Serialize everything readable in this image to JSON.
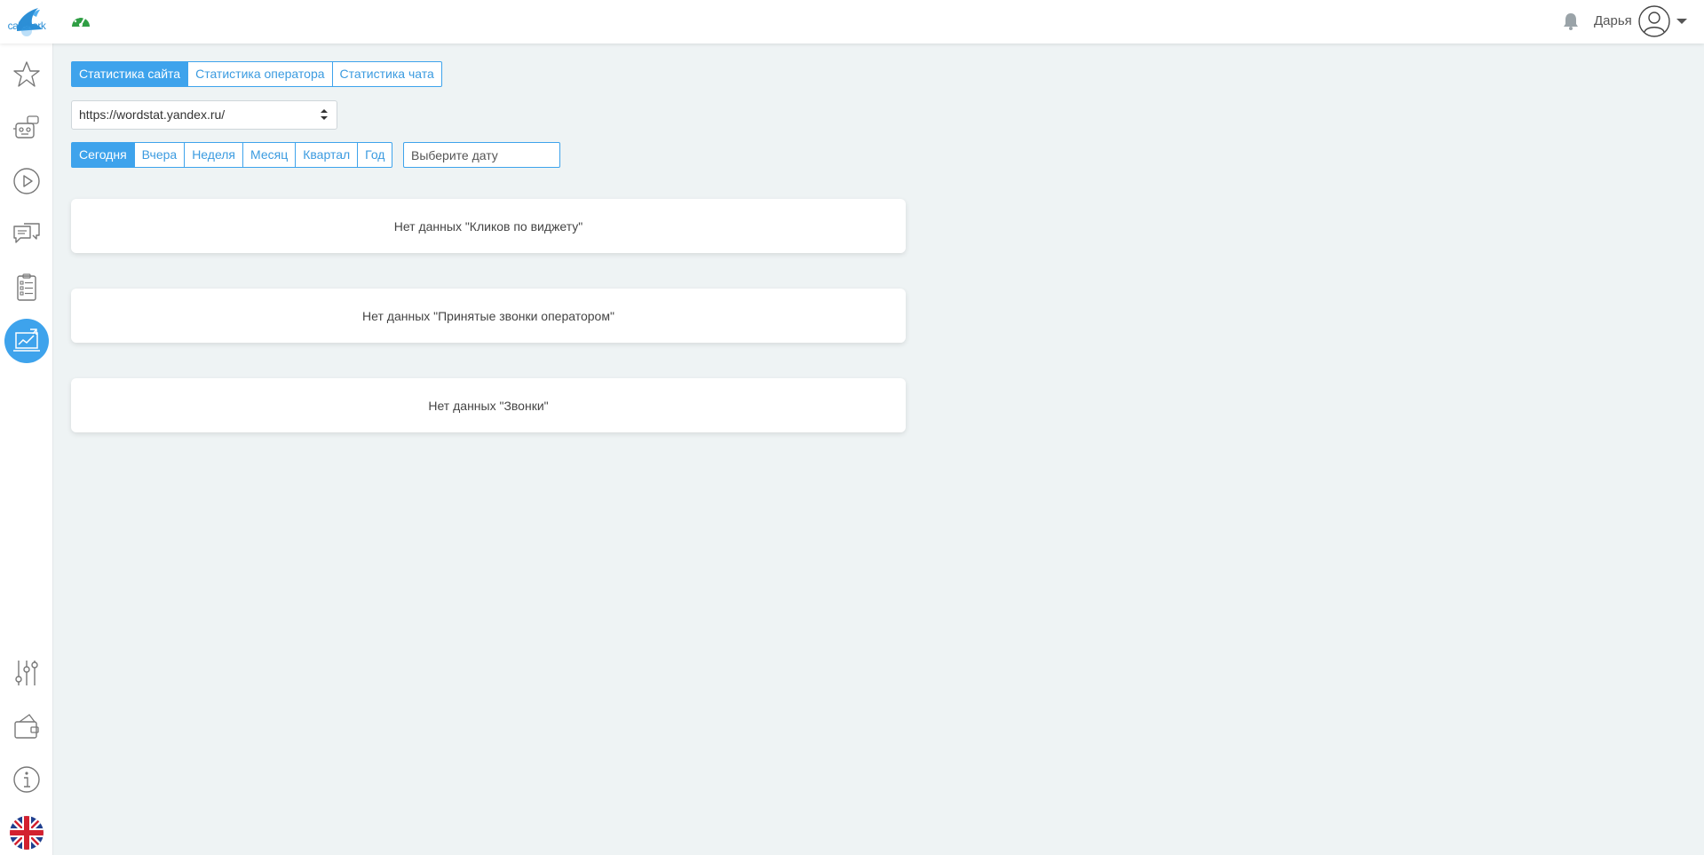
{
  "brand": {
    "logo_text": "callshark",
    "accent": "#3ea3ec"
  },
  "header": {
    "user_name": "Дарья",
    "icons": [
      "speedometer-icon",
      "bell-icon",
      "avatar-icon",
      "caret-down-icon"
    ]
  },
  "sidebar": {
    "items": [
      {
        "name": "favorites",
        "icon": "star-icon"
      },
      {
        "name": "bot",
        "icon": "robot-icon"
      },
      {
        "name": "play",
        "icon": "play-icon"
      },
      {
        "name": "chats",
        "icon": "chat-icon"
      },
      {
        "name": "tasks",
        "icon": "checklist-icon"
      },
      {
        "name": "statistics",
        "icon": "chart-icon",
        "active": true
      },
      {
        "name": "settings",
        "icon": "sliders-icon"
      },
      {
        "name": "wallet",
        "icon": "wallet-icon"
      },
      {
        "name": "info",
        "icon": "info-icon"
      },
      {
        "name": "language",
        "icon": "uk-flag-icon"
      }
    ]
  },
  "tabs": [
    {
      "label": "Статистика сайта",
      "active": true
    },
    {
      "label": "Статистика оператора",
      "active": false
    },
    {
      "label": "Статистика чата",
      "active": false
    }
  ],
  "site_select": {
    "value": "https://wordstat.yandex.ru/"
  },
  "periods": [
    {
      "label": "Сегодня",
      "active": true
    },
    {
      "label": "Вчера",
      "active": false
    },
    {
      "label": "Неделя",
      "active": false
    },
    {
      "label": "Месяц",
      "active": false
    },
    {
      "label": "Квартал",
      "active": false
    },
    {
      "label": "Год",
      "active": false
    }
  ],
  "date_input": {
    "placeholder": "Выберите дату"
  },
  "cards": [
    {
      "text": "Нет данных \"Кликов по виджету\""
    },
    {
      "text": "Нет данных \"Принятые звонки оператором\""
    },
    {
      "text": "Нет данных \"Звонки\""
    }
  ]
}
